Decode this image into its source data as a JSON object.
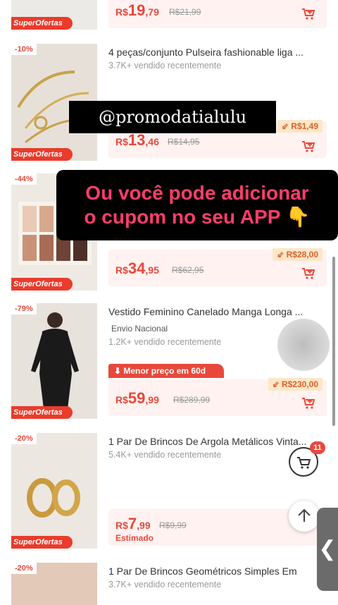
{
  "overlays": {
    "handle": "@promodatialulu",
    "message_line1": "Ou você pode adicionar",
    "message_line2": "o cupom no seu APP"
  },
  "products": [
    {
      "super": "SuperOfertas",
      "price_currency": "R$",
      "price_int": "19",
      "price_cents": ",79",
      "old_price": "R$21,99"
    },
    {
      "discount": "-10%",
      "title": "4 peças/conjunto Pulseira fashionable liga ...",
      "sold": "3.7K+ vendido recentemente",
      "coupon": "R$1,49",
      "super": "SuperOfertas",
      "price_currency": "R$",
      "price_int": "13",
      "price_cents": ",46",
      "old_price": "R$14,95"
    },
    {
      "discount": "-44%",
      "coupon": "R$28,00",
      "super": "SuperOfertas",
      "price_currency": "R$",
      "price_int": "34",
      "price_cents": ",95",
      "old_price": "R$62,95"
    },
    {
      "discount": "-79%",
      "title": "Vestido Feminino Canelado Manga Longa ...",
      "shipping": "Envio Nacional",
      "sold": "1.2K+ vendido recentemente",
      "low_price": "Menor preço em 60d",
      "coupon": "R$230,00",
      "super": "SuperOfertas",
      "price_currency": "R$",
      "price_int": "59",
      "price_cents": ",99",
      "old_price": "R$289,99"
    },
    {
      "discount": "-20%",
      "title": "1 Par De Brincos De Argola Metálicos Vinta...",
      "sold": "5.4K+ vendido recentemente",
      "super": "SuperOfertas",
      "price_currency": "R$",
      "price_int": "7",
      "price_cents": ",99",
      "old_price": "R$9,99",
      "estimate": "Estimado"
    },
    {
      "discount": "-20%",
      "title": "1 Par De Brincos Geométricos Simples Em",
      "sold": "3.7K+ vendido recentemente"
    }
  ],
  "cart_count": "11",
  "colors": {
    "accent": "#e8483b",
    "badge_bg": "#fde7c7"
  }
}
